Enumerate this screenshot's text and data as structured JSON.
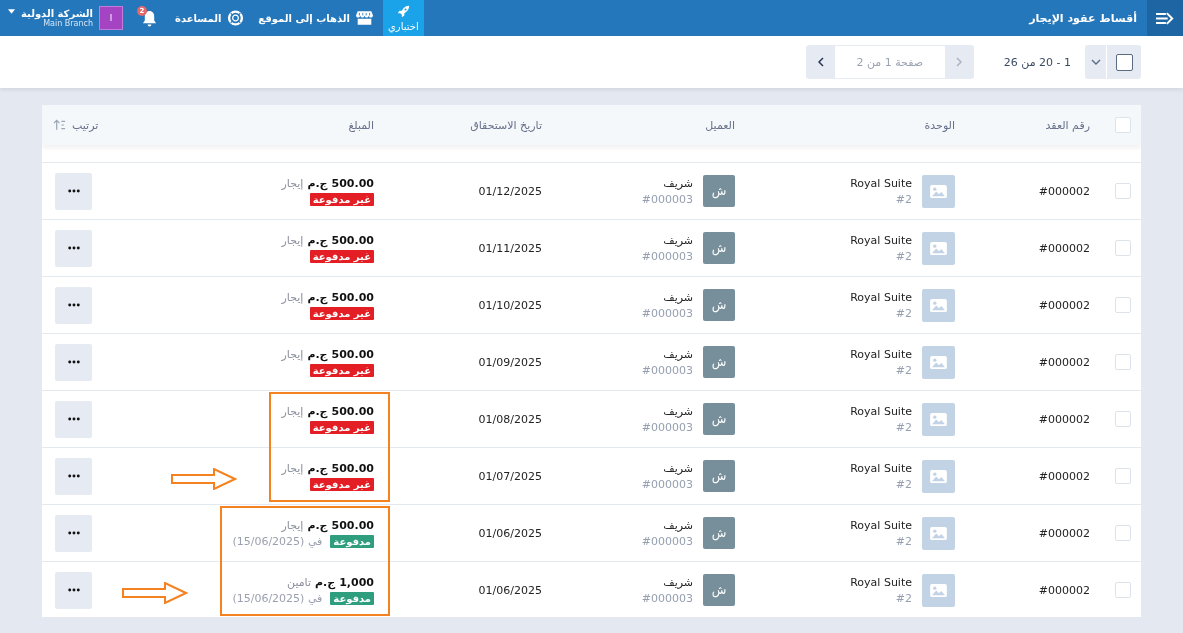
{
  "topbar": {
    "title": "أقساط عقود الإيجار",
    "items": [
      {
        "kind": "tile",
        "label": "اختباري"
      },
      {
        "kind": "site",
        "label": "الذهاب إلى الموقع"
      },
      {
        "kind": "help",
        "label": "المساعدة"
      },
      {
        "kind": "bell",
        "badge": "2"
      }
    ],
    "account": {
      "avatar": "ا",
      "name": "الشركة الدولية",
      "branch": "Main Branch"
    }
  },
  "toolbar": {
    "select_all_checked": false,
    "range": "1 - 20 من 26",
    "page_placeholder": "صفحة 1 من 2",
    "prev_disabled": true,
    "next_disabled": false
  },
  "table": {
    "header_checked": false,
    "columns": [
      "رقم العقد",
      "الوحدة",
      "العميل",
      "تاريخ الاستحقاق",
      "المبلغ",
      "ترتيب"
    ],
    "rows": [
      {
        "checked": false,
        "contract": "#000002",
        "unit": "Royal Suite",
        "unit_no": "#2",
        "avatar": "ش",
        "client": "شريف",
        "client_no": "#000003",
        "due": "01/12/2025",
        "amount": "500.00",
        "currency": "ج.م",
        "type": "إيجار",
        "paid": false,
        "status": "غير مدفوعة"
      },
      {
        "checked": false,
        "contract": "#000002",
        "unit": "Royal Suite",
        "unit_no": "#2",
        "avatar": "ش",
        "client": "شريف",
        "client_no": "#000003",
        "due": "01/11/2025",
        "amount": "500.00",
        "currency": "ج.م",
        "type": "إيجار",
        "paid": false,
        "status": "غير مدفوعة"
      },
      {
        "checked": false,
        "contract": "#000002",
        "unit": "Royal Suite",
        "unit_no": "#2",
        "avatar": "ش",
        "client": "شريف",
        "client_no": "#000003",
        "due": "01/10/2025",
        "amount": "500.00",
        "currency": "ج.م",
        "type": "إيجار",
        "paid": false,
        "status": "غير مدفوعة"
      },
      {
        "checked": false,
        "contract": "#000002",
        "unit": "Royal Suite",
        "unit_no": "#2",
        "avatar": "ش",
        "client": "شريف",
        "client_no": "#000003",
        "due": "01/09/2025",
        "amount": "500.00",
        "currency": "ج.م",
        "type": "إيجار",
        "paid": false,
        "status": "غير مدفوعة"
      },
      {
        "checked": false,
        "contract": "#000002",
        "unit": "Royal Suite",
        "unit_no": "#2",
        "avatar": "ش",
        "client": "شريف",
        "client_no": "#000003",
        "due": "01/08/2025",
        "amount": "500.00",
        "currency": "ج.م",
        "type": "إيجار",
        "paid": false,
        "status": "غير مدفوعة",
        "frame_top": true
      },
      {
        "checked": false,
        "contract": "#000002",
        "unit": "Royal Suite",
        "unit_no": "#2",
        "avatar": "ش",
        "client": "شريف",
        "client_no": "#000003",
        "due": "01/07/2025",
        "amount": "500.00",
        "currency": "ج.م",
        "type": "إيجار",
        "paid": false,
        "status": "غير مدفوعة",
        "frame_bottom": true,
        "arrow": true
      },
      {
        "checked": false,
        "contract": "#000002",
        "unit": "Royal Suite",
        "unit_no": "#2",
        "avatar": "ش",
        "client": "شريف",
        "client_no": "#000003",
        "due": "01/06/2025",
        "amount": "500.00",
        "currency": "ج.م",
        "type": "إيجار",
        "paid": true,
        "status": "مدفوعة",
        "paid_on": "في (15/06/2025)",
        "frame_top": true
      },
      {
        "checked": false,
        "contract": "#000002",
        "unit": "Royal Suite",
        "unit_no": "#2",
        "avatar": "ش",
        "client": "شريف",
        "client_no": "#000003",
        "due": "01/06/2025",
        "amount": "1,000",
        "currency": "ج.م",
        "type": "تامين",
        "paid": true,
        "status": "مدفوعة",
        "paid_on": "في (15/06/2025)",
        "frame_bottom": true,
        "arrow": true
      }
    ]
  }
}
